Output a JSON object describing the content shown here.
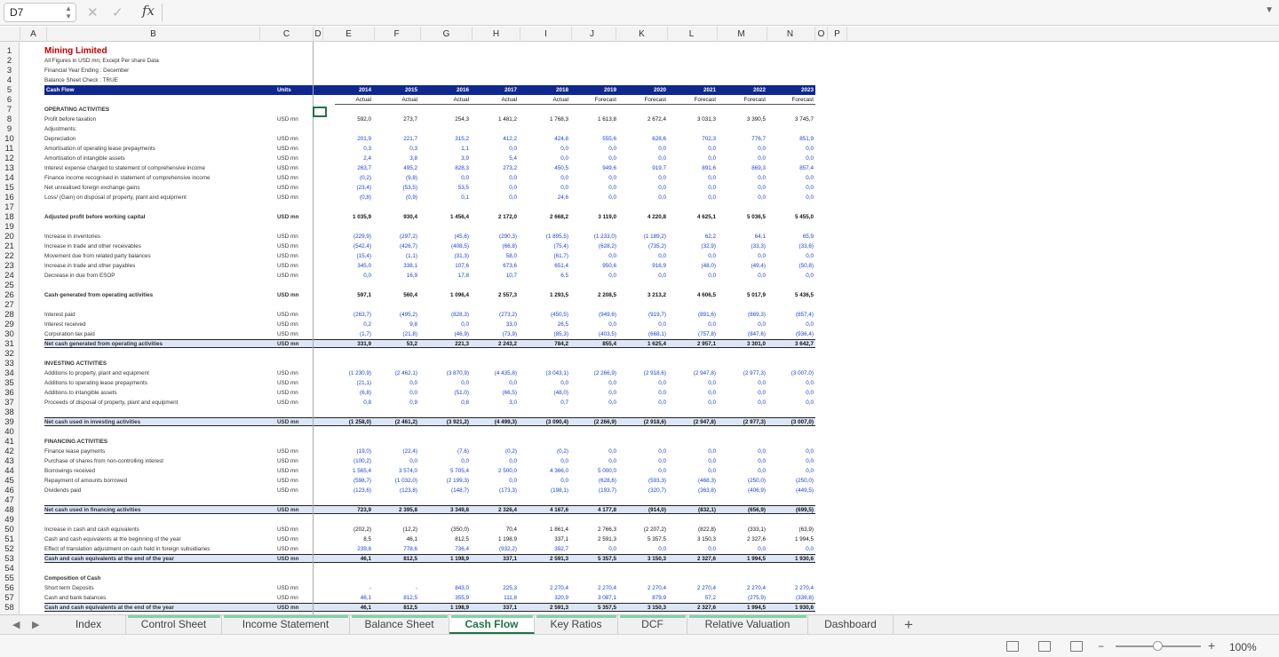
{
  "formula_bar": {
    "name_box": "D7",
    "fx": "fx",
    "formula": ""
  },
  "columns": [
    "A",
    "B",
    "C",
    "D",
    "E",
    "F",
    "G",
    "H",
    "I",
    "J",
    "K",
    "L",
    "M",
    "N",
    "O",
    "P"
  ],
  "sheet": {
    "title": "Mining Limited",
    "sub1": "All Figures in USD mn; Except Per share Data",
    "sub2": "Financial Year Ending : December",
    "sub3": "Balance Sheet Check : TRUE",
    "header_label": "Cash Flow",
    "header_units": "Units",
    "years": [
      "2014",
      "2015",
      "2016",
      "2017",
      "2018",
      "2019",
      "2020",
      "2021",
      "2022",
      "2023"
    ],
    "periods": [
      "Actual",
      "Actual",
      "Actual",
      "Actual",
      "Actual",
      "Forecast",
      "Forecast",
      "Forecast",
      "Forecast",
      "Forecast"
    ],
    "rows": [
      {
        "r": 7,
        "label": "OPERATING ACTIVITIES",
        "bold": true
      },
      {
        "r": 8,
        "label": "Profit before taxation",
        "unit": "USD mn",
        "style": "black",
        "v": [
          "592,0",
          "273,7",
          "254,3",
          "1 481,2",
          "1 768,3",
          "1 613,8",
          "2 672,4",
          "3 031,3",
          "3 390,5",
          "3 745,7"
        ]
      },
      {
        "r": 9,
        "label": "Adjustments:"
      },
      {
        "r": 10,
        "label": "Depreciation",
        "unit": "USD mn",
        "style": "blue",
        "v": [
          "201,9",
          "221,7",
          "315,2",
          "412,2",
          "424,8",
          "555,6",
          "628,6",
          "702,3",
          "776,7",
          "851,9"
        ]
      },
      {
        "r": 11,
        "label": "Amortisation of operating lease prepayments",
        "unit": "USD mn",
        "style": "blue",
        "v": [
          "0,3",
          "0,3",
          "1,1",
          "0,0",
          "0,0",
          "0,0",
          "0,0",
          "0,0",
          "0,0",
          "0,0"
        ]
      },
      {
        "r": 12,
        "label": "Amortisation of intangible assets",
        "unit": "USD mn",
        "style": "blue",
        "v": [
          "2,4",
          "3,8",
          "3,9",
          "5,4",
          "0,0",
          "0,0",
          "0,0",
          "0,0",
          "0,0",
          "0,0"
        ]
      },
      {
        "r": 13,
        "label": "Interest expense charged to statement of comprehensive income",
        "unit": "USD mn",
        "style": "blue",
        "v": [
          "263,7",
          "495,2",
          "828,3",
          "273,2",
          "450,5",
          "949,6",
          "919,7",
          "891,6",
          "869,3",
          "857,4"
        ]
      },
      {
        "r": 14,
        "label": "Finance income recognised in statement of comprehensive income",
        "unit": "USD mn",
        "style": "blue",
        "v": [
          "(0,2)",
          "(9,8)",
          "0,0",
          "0,0",
          "0,0",
          "0,0",
          "0,0",
          "0,0",
          "0,0",
          "0,0"
        ]
      },
      {
        "r": 15,
        "label": "Net unrealised foreign exchange gains",
        "unit": "USD mn",
        "style": "blue",
        "v": [
          "(23,4)",
          "(53,5)",
          "53,5",
          "0,0",
          "0,0",
          "0,0",
          "0,0",
          "0,0",
          "0,0",
          "0,0"
        ]
      },
      {
        "r": 16,
        "label": "Loss/ (Gain) on disposal of property, plant and equipment",
        "unit": "USD mn",
        "style": "blue",
        "v": [
          "(0,8)",
          "(0,9)",
          "0,1",
          "0,0",
          "24,6",
          "0,0",
          "0,0",
          "0,0",
          "0,0",
          "0,0"
        ]
      },
      {
        "r": 18,
        "label": "Adjusted profit before working capital",
        "unit": "USD mn",
        "style": "black",
        "bold": true,
        "v": [
          "1 035,9",
          "930,4",
          "1 456,4",
          "2 172,0",
          "2 668,2",
          "3 119,0",
          "4 220,8",
          "4 625,1",
          "5 036,5",
          "5 455,0"
        ]
      },
      {
        "r": 20,
        "label": "Increase in inventories",
        "unit": "USD mn",
        "style": "blue",
        "v": [
          "(229,9)",
          "(297,2)",
          "(45,6)",
          "(290,3)",
          "(1 895,5)",
          "(1 233,0)",
          "(1 189,2)",
          "62,2",
          "64,1",
          "65,9"
        ]
      },
      {
        "r": 21,
        "label": "Increase in trade and other receivables",
        "unit": "USD mn",
        "style": "blue",
        "v": [
          "(542,4)",
          "(426,7)",
          "(408,5)",
          "(66,8)",
          "(75,4)",
          "(628,2)",
          "(735,2)",
          "(32,9)",
          "(33,3)",
          "(33,6)"
        ]
      },
      {
        "r": 22,
        "label": "Movement due from related party balances",
        "unit": "USD mn",
        "style": "blue",
        "v": [
          "(15,4)",
          "(1,1)",
          "(31,3)",
          "58,0",
          "(61,7)",
          "0,0",
          "0,0",
          "0,0",
          "0,0",
          "0,0"
        ]
      },
      {
        "r": 23,
        "label": "Increase in trade and other payables",
        "unit": "USD mn",
        "style": "blue",
        "v": [
          "345,0",
          "338,1",
          "107,6",
          "673,6",
          "651,4",
          "950,6",
          "916,9",
          "(48,0)",
          "(49,4)",
          "(50,8)"
        ]
      },
      {
        "r": 24,
        "label": "Decrease in due from ESOP",
        "unit": "USD mn",
        "style": "blue",
        "v": [
          "0,0",
          "16,9",
          "17,8",
          "10,7",
          "6,5",
          "0,0",
          "0,0",
          "0,0",
          "0,0",
          "0,0"
        ]
      },
      {
        "r": 26,
        "label": "Cash generated from operating activities",
        "unit": "USD mn",
        "style": "black",
        "bold": true,
        "v": [
          "597,1",
          "560,4",
          "1 096,4",
          "2 557,3",
          "1 293,5",
          "2 208,5",
          "3 213,2",
          "4 606,5",
          "5 017,9",
          "5 436,5"
        ]
      },
      {
        "r": 28,
        "label": "Interest paid",
        "unit": "USD mn",
        "style": "blue",
        "v": [
          "(263,7)",
          "(495,2)",
          "(828,3)",
          "(273,2)",
          "(450,5)",
          "(949,6)",
          "(919,7)",
          "(891,6)",
          "(869,3)",
          "(857,4)"
        ]
      },
      {
        "r": 29,
        "label": "Interest received",
        "unit": "USD mn",
        "style": "blue",
        "v": [
          "0,2",
          "9,8",
          "0,0",
          "33,0",
          "26,5",
          "0,0",
          "0,0",
          "0,0",
          "0,0",
          "0,0"
        ]
      },
      {
        "r": 30,
        "label": "Corporation tax paid",
        "unit": "USD mn",
        "style": "blue",
        "v": [
          "(1,7)",
          "(21,8)",
          "(46,9)",
          "(73,9)",
          "(85,3)",
          "(403,5)",
          "(668,1)",
          "(757,8)",
          "(847,6)",
          "(936,4)"
        ]
      },
      {
        "r": 31,
        "label": "Net cash generated from operating activities",
        "unit": "USD mn",
        "style": "black",
        "bold": true,
        "highlight": true,
        "v": [
          "331,9",
          "53,2",
          "221,3",
          "2 243,2",
          "784,2",
          "855,4",
          "1 625,4",
          "2 957,1",
          "3 301,0",
          "3 642,7"
        ]
      },
      {
        "r": 33,
        "label": "INVESTING ACTIVITIES",
        "bold": true
      },
      {
        "r": 34,
        "label": "Additions to property, plant and equipment",
        "unit": "USD mn",
        "style": "blue",
        "v": [
          "(1 230,9)",
          "(2 462,1)",
          "(3 870,9)",
          "(4 435,8)",
          "(3 043,1)",
          "(2 266,9)",
          "(2 918,6)",
          "(2 947,8)",
          "(2 977,3)",
          "(3 007,0)"
        ]
      },
      {
        "r": 35,
        "label": "Additions to operating lease prepayments",
        "unit": "USD mn",
        "style": "blue",
        "v": [
          "(21,1)",
          "0,0",
          "0,0",
          "0,0",
          "0,0",
          "0,0",
          "0,0",
          "0,0",
          "0,0",
          "0,0"
        ]
      },
      {
        "r": 36,
        "label": "Additions to intangible assets",
        "unit": "USD mn",
        "style": "blue",
        "v": [
          "(6,8)",
          "0,0",
          "(51,0)",
          "(66,5)",
          "(48,0)",
          "0,0",
          "0,0",
          "0,0",
          "0,0",
          "0,0"
        ]
      },
      {
        "r": 37,
        "label": "Proceeds of disposal of property, plant and equipment",
        "unit": "USD mn",
        "style": "blue",
        "v": [
          "0,8",
          "0,9",
          "0,8",
          "3,0",
          "0,7",
          "0,0",
          "0,0",
          "0,0",
          "0,0",
          "0,0"
        ]
      },
      {
        "r": 39,
        "label": "Net cash used in investing activities",
        "unit": "USD mn",
        "style": "black",
        "bold": true,
        "highlight": true,
        "v": [
          "(1 258,0)",
          "(2 461,2)",
          "(3 921,2)",
          "(4 499,3)",
          "(3 090,4)",
          "(2 266,9)",
          "(2 918,6)",
          "(2 947,8)",
          "(2 977,3)",
          "(3 007,0)"
        ]
      },
      {
        "r": 41,
        "label": "FINANCING ACTIVITIES",
        "bold": true
      },
      {
        "r": 42,
        "label": "Finance lease payments",
        "unit": "USD mn",
        "style": "blue",
        "v": [
          "(19,0)",
          "(22,4)",
          "(7,6)",
          "(0,2)",
          "(0,2)",
          "0,0",
          "0,0",
          "0,0",
          "0,0",
          "0,0"
        ]
      },
      {
        "r": 43,
        "label": "Purchase of shares from non-controlling interest",
        "unit": "USD mn",
        "style": "blue",
        "v": [
          "(100,2)",
          "0,0",
          "0,0",
          "0,0",
          "0,0",
          "0,0",
          "0,0",
          "0,0",
          "0,0",
          "0,0"
        ]
      },
      {
        "r": 44,
        "label": "Borrowings received",
        "unit": "USD mn",
        "style": "blue",
        "v": [
          "1 565,4",
          "3 574,0",
          "5 705,4",
          "2 500,0",
          "4 366,0",
          "5 000,0",
          "0,0",
          "0,0",
          "0,0",
          "0,0"
        ]
      },
      {
        "r": 45,
        "label": "Repayment of amounts borrowed",
        "unit": "USD mn",
        "style": "blue",
        "v": [
          "(598,7)",
          "(1 032,0)",
          "(2 199,3)",
          "0,0",
          "0,0",
          "(628,6)",
          "(593,3)",
          "(468,3)",
          "(250,0)",
          "(250,0)"
        ]
      },
      {
        "r": 46,
        "label": "Dividends paid",
        "unit": "USD mn",
        "style": "blue",
        "v": [
          "(123,6)",
          "(123,8)",
          "(148,7)",
          "(173,3)",
          "(198,1)",
          "(193,7)",
          "(320,7)",
          "(363,8)",
          "(406,9)",
          "(449,5)"
        ]
      },
      {
        "r": 48,
        "label": "Net cash used in financing activities",
        "unit": "USD mn",
        "style": "black",
        "bold": true,
        "highlight": true,
        "v": [
          "723,9",
          "2 395,8",
          "3 349,8",
          "2 326,4",
          "4 167,6",
          "4 177,8",
          "(914,0)",
          "(832,1)",
          "(656,9)",
          "(699,5)"
        ]
      },
      {
        "r": 50,
        "label": "Increase in cash and cash equivalents",
        "unit": "USD mn",
        "style": "black",
        "v": [
          "(202,2)",
          "(12,2)",
          "(350,0)",
          "70,4",
          "1 861,4",
          "2 766,3",
          "(2 207,2)",
          "(822,8)",
          "(333,1)",
          "(63,9)"
        ]
      },
      {
        "r": 51,
        "label": "Cash and cash equivalents at the beginning of the year",
        "unit": "USD mn",
        "style": "black",
        "v": [
          "8,5",
          "46,1",
          "812,5",
          "1 198,9",
          "337,1",
          "2 591,3",
          "5 357,5",
          "3 150,3",
          "2 327,6",
          "1 994,5"
        ]
      },
      {
        "r": 52,
        "label": "Effect of translation adjustment on cash held in foreign subsidiaries",
        "unit": "USD mn",
        "style": "blue",
        "v": [
          "239,8",
          "778,6",
          "736,4",
          "(932,2)",
          "392,7",
          "0,0",
          "0,0",
          "0,0",
          "0,0",
          "0,0"
        ]
      },
      {
        "r": 53,
        "label": "Cash and cash equivalents at the end of the year",
        "unit": "USD mn",
        "style": "black",
        "bold": true,
        "highlight": true,
        "v": [
          "46,1",
          "812,5",
          "1 198,9",
          "337,1",
          "2 591,3",
          "5 357,5",
          "3 150,3",
          "2 327,6",
          "1 994,5",
          "1 930,6"
        ]
      },
      {
        "r": 55,
        "label": "Composition of Cash",
        "bold": true
      },
      {
        "r": 56,
        "label": "Short term Deposits",
        "unit": "USD mn",
        "style": "blue",
        "v": [
          "-",
          "-",
          "843,0",
          "225,3",
          "2 270,4",
          "2 270,4",
          "2 270,4",
          "2 270,4",
          "2 270,4",
          "2 270,4"
        ]
      },
      {
        "r": 57,
        "label": "Cash and bank balances",
        "unit": "USD mn",
        "style": "blue",
        "v": [
          "46,1",
          "812,5",
          "355,9",
          "111,8",
          "320,9",
          "3 087,1",
          "879,9",
          "57,2",
          "(275,9)",
          "(339,8)"
        ]
      },
      {
        "r": 58,
        "label": "Cash and cash equivalents at the end of the year",
        "unit": "USD mn",
        "style": "black",
        "bold": true,
        "highlight": true,
        "v": [
          "46,1",
          "812,5",
          "1 198,9",
          "337,1",
          "2 591,3",
          "5 357,5",
          "3 150,3",
          "2 327,6",
          "1 994,5",
          "1 930,6"
        ]
      }
    ]
  },
  "tabs": [
    "Index",
    "Control Sheet",
    "Income Statement",
    "Balance Sheet",
    "Cash Flow",
    "Key Ratios",
    "DCF",
    "Relative Valuation",
    "Dashboard"
  ],
  "active_tab": "Cash Flow",
  "add_sheet": "+",
  "zoom": "100%",
  "zoom_minus": "−",
  "zoom_plus": "+"
}
